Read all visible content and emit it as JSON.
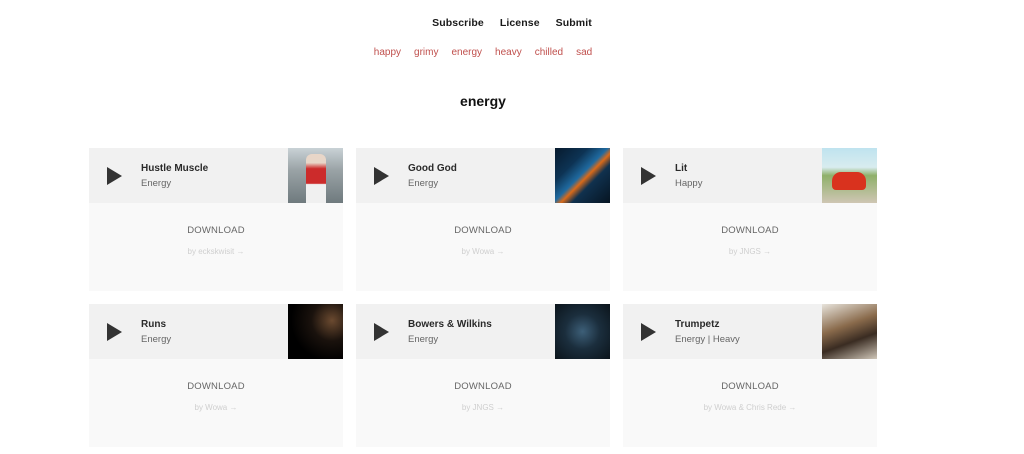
{
  "nav": {
    "subscribe": "Subscribe",
    "license": "License",
    "submit": "Submit"
  },
  "moods": [
    "happy",
    "grimy",
    "energy",
    "heavy",
    "chilled",
    "sad"
  ],
  "page_title": "energy",
  "colors": {
    "mood_link": "#c0504d",
    "card_header_bg": "#f1f1f1",
    "card_body_bg": "#f9f9f9"
  },
  "tracks": [
    {
      "title": "Hustle Muscle",
      "tags": "Energy",
      "download": "DOWNLOAD",
      "byline": "by eckskwisit →",
      "play_icon": "play-icon"
    },
    {
      "title": "Good God",
      "tags": "Energy",
      "download": "DOWNLOAD",
      "byline": "by Wowa →",
      "play_icon": "play-icon"
    },
    {
      "title": "Lit",
      "tags": "Happy",
      "download": "DOWNLOAD",
      "byline": "by JNGS →",
      "play_icon": "play-icon"
    },
    {
      "title": "Runs",
      "tags": "Energy",
      "download": "DOWNLOAD",
      "byline": "by Wowa →",
      "play_icon": "play-icon"
    },
    {
      "title": "Bowers & Wilkins",
      "tags": "Energy",
      "download": "DOWNLOAD",
      "byline": "by JNGS →",
      "play_icon": "play-icon"
    },
    {
      "title": "Trumpetz",
      "tags": "Energy | Heavy",
      "download": "DOWNLOAD",
      "byline": "by Wowa & Chris Rede →",
      "play_icon": "play-icon"
    }
  ]
}
